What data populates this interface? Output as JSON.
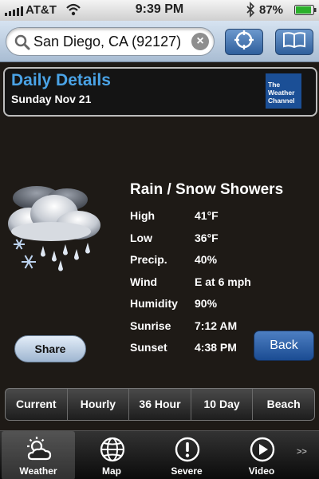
{
  "status_bar": {
    "carrier": "AT&T",
    "time": "9:39 PM",
    "battery": "87%"
  },
  "search": {
    "value": "San Diego, CA (92127)"
  },
  "details_header": {
    "title": "Daily Details",
    "date": "Sunday Nov 21",
    "logo_text": "The Weather Channel"
  },
  "forecast": {
    "condition": "Rain / Snow Showers",
    "icon": "cloud-rain-snow-icon",
    "rows": [
      {
        "label": "High",
        "value": "41°F"
      },
      {
        "label": "Low",
        "value": "36°F"
      },
      {
        "label": "Precip.",
        "value": "40%"
      },
      {
        "label": "Wind",
        "value": "E at 6 mph"
      },
      {
        "label": "Humidity",
        "value": "90%"
      },
      {
        "label": "Sunrise",
        "value": "7:12 AM"
      },
      {
        "label": "Sunset",
        "value": "4:38 PM"
      }
    ]
  },
  "buttons": {
    "share": "Share",
    "back": "Back"
  },
  "segments": [
    "Current",
    "Hourly",
    "36 Hour",
    "10 Day",
    "Beach"
  ],
  "tabs": [
    {
      "label": "Weather",
      "icon": "sun-cloud-icon"
    },
    {
      "label": "Map",
      "icon": "globe-icon"
    },
    {
      "label": "Severe",
      "icon": "exclamation-icon"
    },
    {
      "label": "Video",
      "icon": "play-icon"
    }
  ],
  "tab_more": ">>",
  "colors": {
    "title_blue": "#4aa3e6",
    "background": "#1e1a16",
    "button_blue": "#1b4c93"
  }
}
